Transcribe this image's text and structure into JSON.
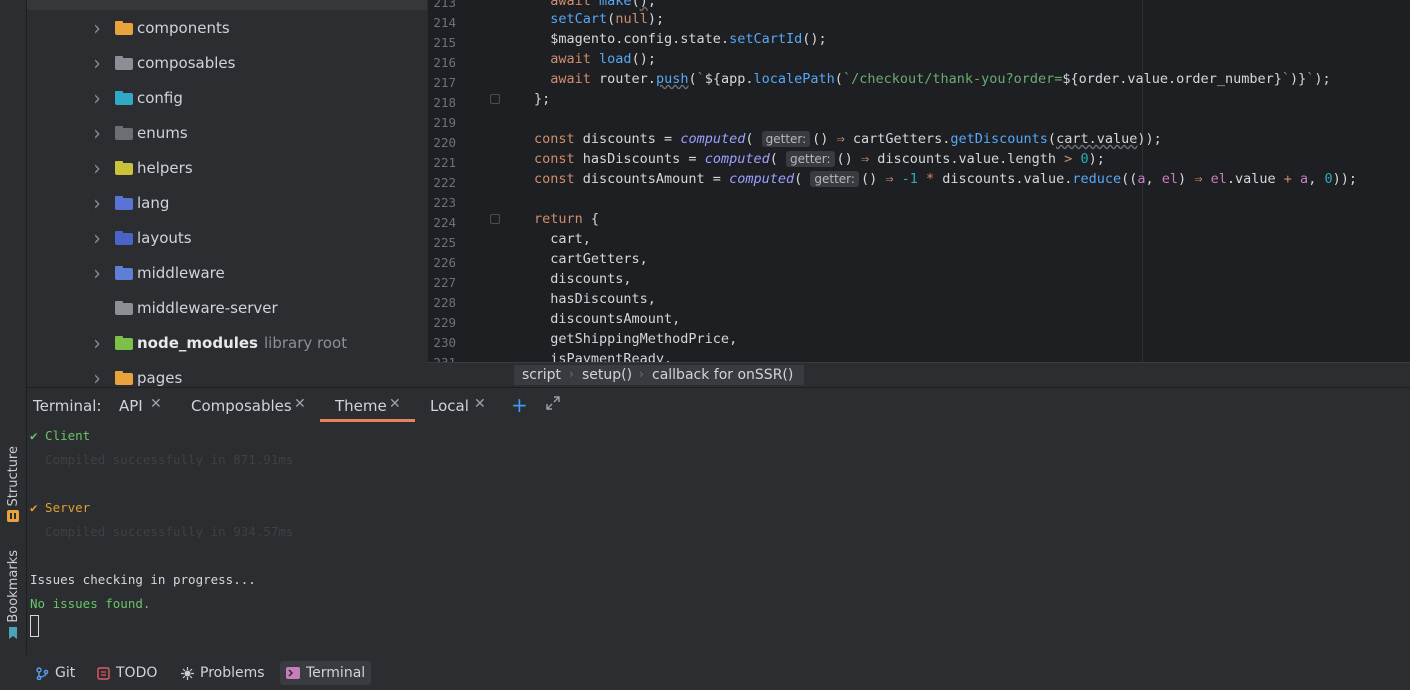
{
  "side_tabs": {
    "structure": "Structure",
    "bookmarks": "Bookmarks"
  },
  "project_tree": {
    "items": [
      {
        "label": "components",
        "hint": "",
        "expandable": true,
        "color": "#e8a33c",
        "badge": ""
      },
      {
        "label": "composables",
        "hint": "",
        "expandable": true,
        "color": "#8c8f96",
        "badge": ""
      },
      {
        "label": "config",
        "hint": "",
        "expandable": true,
        "color": "#2fa9c5",
        "badge": ""
      },
      {
        "label": "enums",
        "hint": "",
        "expandable": true,
        "color": "#6b6e75",
        "badge": ""
      },
      {
        "label": "helpers",
        "hint": "",
        "expandable": true,
        "color": "#c9c23b",
        "badge": ""
      },
      {
        "label": "lang",
        "hint": "",
        "expandable": true,
        "color": "#5a74d6",
        "badge": ""
      },
      {
        "label": "layouts",
        "hint": "",
        "expandable": true,
        "color": "#4a63c9",
        "badge": ""
      },
      {
        "label": "middleware",
        "hint": "",
        "expandable": true,
        "color": "#5f7fd6",
        "badge": ""
      },
      {
        "label": "middleware-server",
        "hint": "",
        "expandable": false,
        "color": "#8c8f96",
        "badge": ""
      },
      {
        "label": "node_modules",
        "hint": "library root",
        "expandable": true,
        "color": "#7cc04a",
        "badge": ""
      },
      {
        "label": "pages",
        "hint": "",
        "expandable": true,
        "color": "#e8a33c",
        "badge": ""
      }
    ]
  },
  "editor": {
    "line_numbers": [
      "213",
      "214",
      "215",
      "216",
      "217",
      "218",
      "219",
      "220",
      "221",
      "222",
      "223",
      "224",
      "225",
      "226",
      "227",
      "228",
      "229",
      "230",
      "231"
    ]
  },
  "breadcrumb": {
    "items": [
      "script",
      "setup()",
      "callback for onSSR()"
    ]
  },
  "terminal": {
    "label": "Terminal:",
    "tabs": [
      "API",
      "Composables",
      "Theme",
      "Local"
    ],
    "active_tab": "Theme",
    "lines": {
      "client": "✔ Client",
      "client_compiled": "  Compiled successfully in 871.91ms",
      "server": "✔ Server",
      "server_compiled": "  Compiled successfully in 934.57ms",
      "issues": "Issues checking in progress...",
      "no_issues": "No issues found."
    }
  },
  "bottom_bar": {
    "items": [
      {
        "label": "Git",
        "icon": "git-branch-icon"
      },
      {
        "label": "TODO",
        "icon": "todo-icon"
      },
      {
        "label": "Problems",
        "icon": "problems-icon"
      },
      {
        "label": "Terminal",
        "icon": "terminal-icon"
      }
    ],
    "active": "Terminal"
  },
  "colors": {
    "accent": "#e5825f",
    "link": "#3f9cf5",
    "success": "#69c569",
    "warning": "#e0a030"
  }
}
